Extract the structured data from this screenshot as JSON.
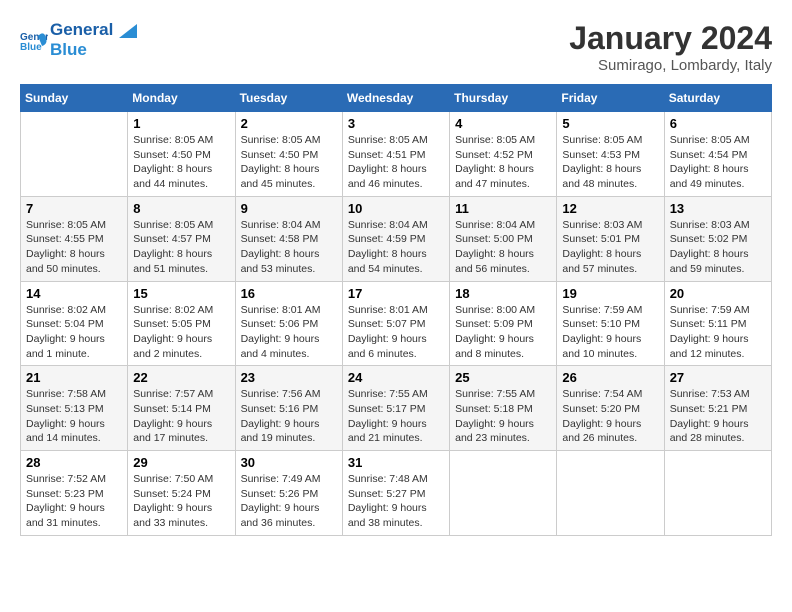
{
  "header": {
    "logo_line1": "General",
    "logo_line2": "Blue",
    "month": "January 2024",
    "location": "Sumirago, Lombardy, Italy"
  },
  "days_of_week": [
    "Sunday",
    "Monday",
    "Tuesday",
    "Wednesday",
    "Thursday",
    "Friday",
    "Saturday"
  ],
  "weeks": [
    [
      {
        "day": "",
        "sunrise": "",
        "sunset": "",
        "daylight": ""
      },
      {
        "day": "1",
        "sunrise": "Sunrise: 8:05 AM",
        "sunset": "Sunset: 4:50 PM",
        "daylight": "Daylight: 8 hours and 44 minutes."
      },
      {
        "day": "2",
        "sunrise": "Sunrise: 8:05 AM",
        "sunset": "Sunset: 4:50 PM",
        "daylight": "Daylight: 8 hours and 45 minutes."
      },
      {
        "day": "3",
        "sunrise": "Sunrise: 8:05 AM",
        "sunset": "Sunset: 4:51 PM",
        "daylight": "Daylight: 8 hours and 46 minutes."
      },
      {
        "day": "4",
        "sunrise": "Sunrise: 8:05 AM",
        "sunset": "Sunset: 4:52 PM",
        "daylight": "Daylight: 8 hours and 47 minutes."
      },
      {
        "day": "5",
        "sunrise": "Sunrise: 8:05 AM",
        "sunset": "Sunset: 4:53 PM",
        "daylight": "Daylight: 8 hours and 48 minutes."
      },
      {
        "day": "6",
        "sunrise": "Sunrise: 8:05 AM",
        "sunset": "Sunset: 4:54 PM",
        "daylight": "Daylight: 8 hours and 49 minutes."
      }
    ],
    [
      {
        "day": "7",
        "sunrise": "Sunrise: 8:05 AM",
        "sunset": "Sunset: 4:55 PM",
        "daylight": "Daylight: 8 hours and 50 minutes."
      },
      {
        "day": "8",
        "sunrise": "Sunrise: 8:05 AM",
        "sunset": "Sunset: 4:57 PM",
        "daylight": "Daylight: 8 hours and 51 minutes."
      },
      {
        "day": "9",
        "sunrise": "Sunrise: 8:04 AM",
        "sunset": "Sunset: 4:58 PM",
        "daylight": "Daylight: 8 hours and 53 minutes."
      },
      {
        "day": "10",
        "sunrise": "Sunrise: 8:04 AM",
        "sunset": "Sunset: 4:59 PM",
        "daylight": "Daylight: 8 hours and 54 minutes."
      },
      {
        "day": "11",
        "sunrise": "Sunrise: 8:04 AM",
        "sunset": "Sunset: 5:00 PM",
        "daylight": "Daylight: 8 hours and 56 minutes."
      },
      {
        "day": "12",
        "sunrise": "Sunrise: 8:03 AM",
        "sunset": "Sunset: 5:01 PM",
        "daylight": "Daylight: 8 hours and 57 minutes."
      },
      {
        "day": "13",
        "sunrise": "Sunrise: 8:03 AM",
        "sunset": "Sunset: 5:02 PM",
        "daylight": "Daylight: 8 hours and 59 minutes."
      }
    ],
    [
      {
        "day": "14",
        "sunrise": "Sunrise: 8:02 AM",
        "sunset": "Sunset: 5:04 PM",
        "daylight": "Daylight: 9 hours and 1 minute."
      },
      {
        "day": "15",
        "sunrise": "Sunrise: 8:02 AM",
        "sunset": "Sunset: 5:05 PM",
        "daylight": "Daylight: 9 hours and 2 minutes."
      },
      {
        "day": "16",
        "sunrise": "Sunrise: 8:01 AM",
        "sunset": "Sunset: 5:06 PM",
        "daylight": "Daylight: 9 hours and 4 minutes."
      },
      {
        "day": "17",
        "sunrise": "Sunrise: 8:01 AM",
        "sunset": "Sunset: 5:07 PM",
        "daylight": "Daylight: 9 hours and 6 minutes."
      },
      {
        "day": "18",
        "sunrise": "Sunrise: 8:00 AM",
        "sunset": "Sunset: 5:09 PM",
        "daylight": "Daylight: 9 hours and 8 minutes."
      },
      {
        "day": "19",
        "sunrise": "Sunrise: 7:59 AM",
        "sunset": "Sunset: 5:10 PM",
        "daylight": "Daylight: 9 hours and 10 minutes."
      },
      {
        "day": "20",
        "sunrise": "Sunrise: 7:59 AM",
        "sunset": "Sunset: 5:11 PM",
        "daylight": "Daylight: 9 hours and 12 minutes."
      }
    ],
    [
      {
        "day": "21",
        "sunrise": "Sunrise: 7:58 AM",
        "sunset": "Sunset: 5:13 PM",
        "daylight": "Daylight: 9 hours and 14 minutes."
      },
      {
        "day": "22",
        "sunrise": "Sunrise: 7:57 AM",
        "sunset": "Sunset: 5:14 PM",
        "daylight": "Daylight: 9 hours and 17 minutes."
      },
      {
        "day": "23",
        "sunrise": "Sunrise: 7:56 AM",
        "sunset": "Sunset: 5:16 PM",
        "daylight": "Daylight: 9 hours and 19 minutes."
      },
      {
        "day": "24",
        "sunrise": "Sunrise: 7:55 AM",
        "sunset": "Sunset: 5:17 PM",
        "daylight": "Daylight: 9 hours and 21 minutes."
      },
      {
        "day": "25",
        "sunrise": "Sunrise: 7:55 AM",
        "sunset": "Sunset: 5:18 PM",
        "daylight": "Daylight: 9 hours and 23 minutes."
      },
      {
        "day": "26",
        "sunrise": "Sunrise: 7:54 AM",
        "sunset": "Sunset: 5:20 PM",
        "daylight": "Daylight: 9 hours and 26 minutes."
      },
      {
        "day": "27",
        "sunrise": "Sunrise: 7:53 AM",
        "sunset": "Sunset: 5:21 PM",
        "daylight": "Daylight: 9 hours and 28 minutes."
      }
    ],
    [
      {
        "day": "28",
        "sunrise": "Sunrise: 7:52 AM",
        "sunset": "Sunset: 5:23 PM",
        "daylight": "Daylight: 9 hours and 31 minutes."
      },
      {
        "day": "29",
        "sunrise": "Sunrise: 7:50 AM",
        "sunset": "Sunset: 5:24 PM",
        "daylight": "Daylight: 9 hours and 33 minutes."
      },
      {
        "day": "30",
        "sunrise": "Sunrise: 7:49 AM",
        "sunset": "Sunset: 5:26 PM",
        "daylight": "Daylight: 9 hours and 36 minutes."
      },
      {
        "day": "31",
        "sunrise": "Sunrise: 7:48 AM",
        "sunset": "Sunset: 5:27 PM",
        "daylight": "Daylight: 9 hours and 38 minutes."
      },
      {
        "day": "",
        "sunrise": "",
        "sunset": "",
        "daylight": ""
      },
      {
        "day": "",
        "sunrise": "",
        "sunset": "",
        "daylight": ""
      },
      {
        "day": "",
        "sunrise": "",
        "sunset": "",
        "daylight": ""
      }
    ]
  ]
}
